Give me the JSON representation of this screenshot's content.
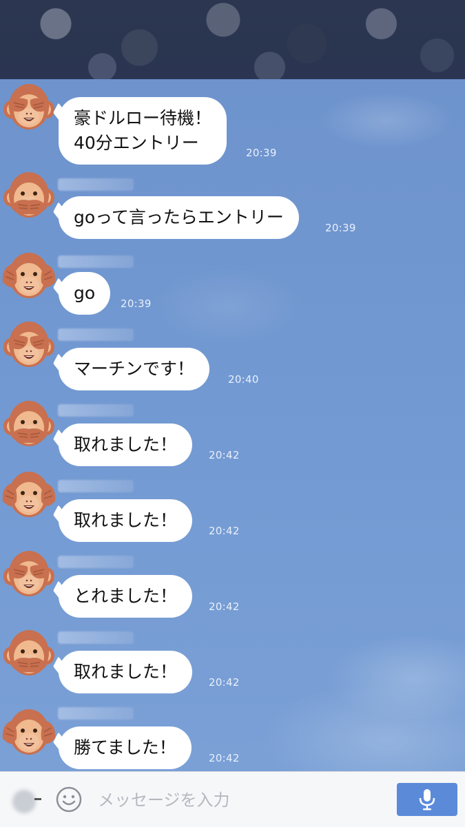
{
  "messages": [
    {
      "text": "豪ドルロー待機！\n40分エントリー",
      "time": "20:39",
      "avatar": "see-no-evil-monkey"
    },
    {
      "text": "goって言ったらエントリー",
      "time": "20:39",
      "avatar": "speak-no-evil-monkey"
    },
    {
      "text": "go",
      "time": "20:39",
      "avatar": "hear-no-evil-monkey"
    },
    {
      "text": "マーチンです！",
      "time": "20:40",
      "avatar": "see-no-evil-monkey"
    },
    {
      "text": "取れました！",
      "time": "20:42",
      "avatar": "speak-no-evil-monkey"
    },
    {
      "text": "取れました！",
      "time": "20:42",
      "avatar": "hear-no-evil-monkey"
    },
    {
      "text": "とれました！",
      "time": "20:42",
      "avatar": "see-no-evil-monkey"
    },
    {
      "text": "取れました！",
      "time": "20:42",
      "avatar": "speak-no-evil-monkey"
    },
    {
      "text": "勝てました！",
      "time": "20:42",
      "avatar": "hear-no-evil-monkey"
    }
  ],
  "input": {
    "placeholder": "メッセージを入力"
  },
  "icons": {
    "emoji": "smiley-icon",
    "mic": "microphone-icon"
  },
  "colors": {
    "bubble": "#ffffff",
    "chat_background": "#7299d2",
    "send_button": "#5b8ad9",
    "monkey_face": "#c8704f"
  }
}
